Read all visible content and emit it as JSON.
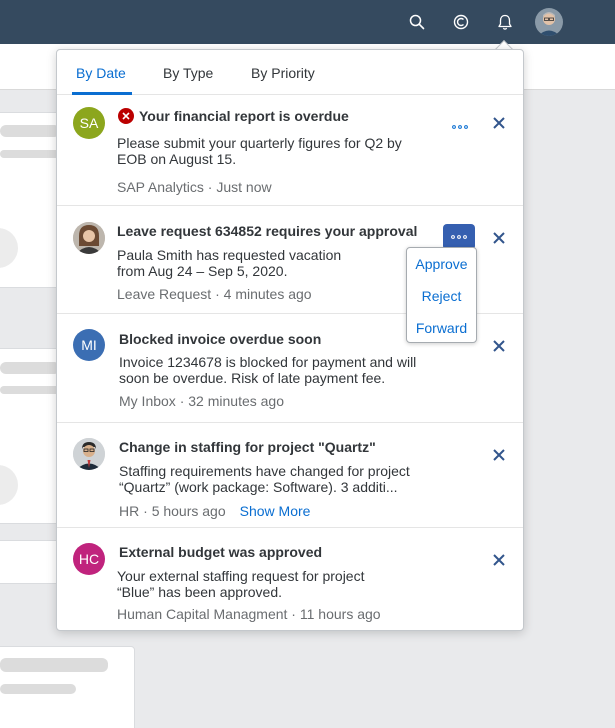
{
  "shellbar": {
    "icons": [
      "search-icon",
      "copilot-icon",
      "bell-icon",
      "user-avatar"
    ]
  },
  "colors": {
    "shell": "#354a5f",
    "accent": "#0a6ed1",
    "error": "#bb0000",
    "avatar_sa": "#8ca61d",
    "avatar_mi": "#3b6eb3",
    "avatar_hc": "#c0237d"
  },
  "tabs": [
    {
      "label": "By Date",
      "active": true
    },
    {
      "label": "By Type",
      "active": false
    },
    {
      "label": "By Priority",
      "active": false
    }
  ],
  "notifications": [
    {
      "avatar_initials": "SA",
      "status_icon": "error-icon",
      "title": "Your financial report is overdue",
      "description": "Please submit your quarterly figures for Q2 by EOB on August 15.",
      "source": "SAP Analytics",
      "time": "Just now"
    },
    {
      "avatar_initials": "",
      "avatar_type": "photo",
      "title": "Leave request 634852 requires your approval",
      "description": "Paula Smith has requested vacation from Aug 24 – Sep 5, 2020.",
      "source": "Leave Request",
      "time": "4 minutes ago"
    },
    {
      "avatar_initials": "MI",
      "title": "Blocked invoice overdue soon",
      "description": "Invoice 1234678 is blocked for payment and will soon be overdue. Risk of late payment fee.",
      "source": "My Inbox",
      "time": "32 minutes ago"
    },
    {
      "avatar_initials": "",
      "avatar_type": "photo",
      "title": "Change in staffing for project \"Quartz\"",
      "description": "Staffing requirements have changed for project “Quartz” (work package: Software). 3 additi...",
      "source": "HR",
      "time": "5 hours ago",
      "link": "Show More"
    },
    {
      "avatar_initials": "HC",
      "title": "External budget was approved",
      "description": "Your external staffing request for project “Blue” has been approved.",
      "source": "Human Capital Managment",
      "time": "11 hours ago"
    }
  ],
  "action_menu": {
    "items": [
      "Approve",
      "Reject",
      "Forward"
    ]
  }
}
